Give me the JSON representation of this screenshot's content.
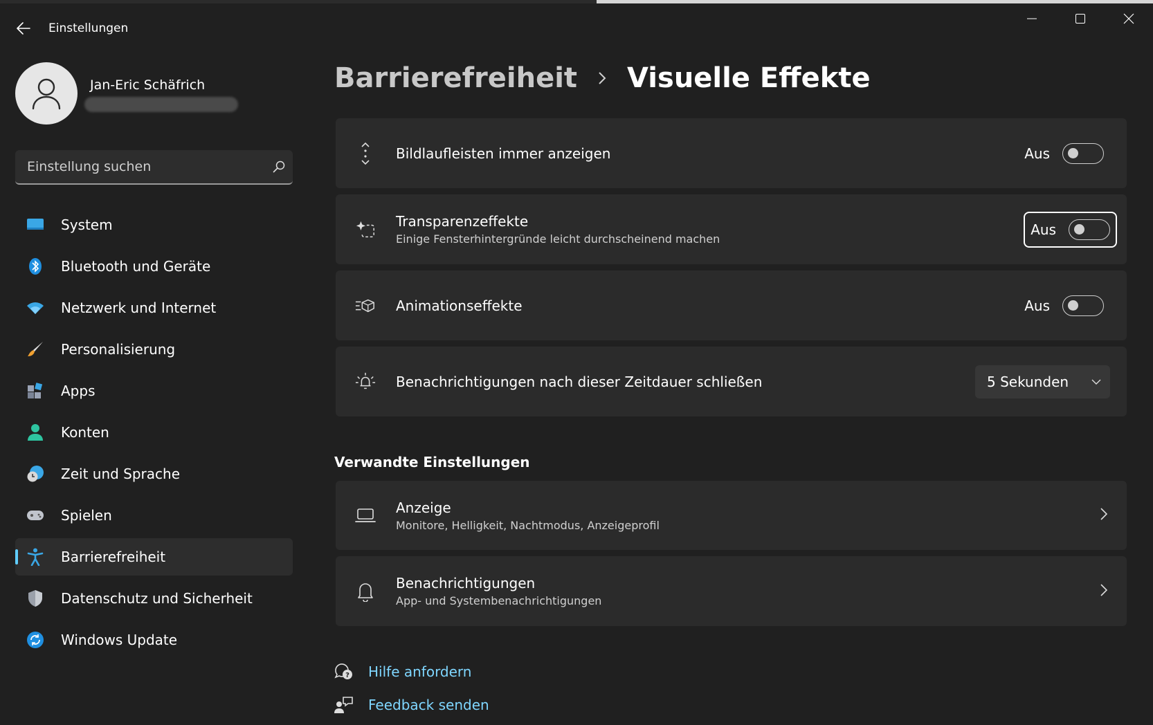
{
  "window": {
    "title": "Einstellungen"
  },
  "profile": {
    "name": "Jan-Eric Schäfrich"
  },
  "search": {
    "placeholder": "Einstellung suchen"
  },
  "nav": {
    "items": [
      {
        "label": "System",
        "icon": "system-icon"
      },
      {
        "label": "Bluetooth und Geräte",
        "icon": "bluetooth-icon"
      },
      {
        "label": "Netzwerk und Internet",
        "icon": "wifi-icon"
      },
      {
        "label": "Personalisierung",
        "icon": "brush-icon"
      },
      {
        "label": "Apps",
        "icon": "apps-icon"
      },
      {
        "label": "Konten",
        "icon": "account-icon"
      },
      {
        "label": "Zeit und Sprache",
        "icon": "clock-globe-icon"
      },
      {
        "label": "Spielen",
        "icon": "gamepad-icon"
      },
      {
        "label": "Barrierefreiheit",
        "icon": "accessibility-icon",
        "active": true
      },
      {
        "label": "Datenschutz und Sicherheit",
        "icon": "shield-icon"
      },
      {
        "label": "Windows Update",
        "icon": "update-icon"
      }
    ]
  },
  "breadcrumb": {
    "parent": "Barrierefreiheit",
    "current": "Visuelle Effekte"
  },
  "settings": {
    "scrollbars": {
      "title": "Bildlaufleisten immer anzeigen",
      "state_label": "Aus",
      "on": false
    },
    "transparency": {
      "title": "Transparenzeffekte",
      "subtitle": "Einige Fensterhintergründe leicht durchscheinend machen",
      "state_label": "Aus",
      "on": false
    },
    "animation": {
      "title": "Animationseffekte",
      "state_label": "Aus",
      "on": false
    },
    "notifications_timeout": {
      "title": "Benachrichtigungen nach dieser Zeitdauer schließen",
      "value": "5 Sekunden"
    }
  },
  "related": {
    "section_title": "Verwandte Einstellungen",
    "display": {
      "title": "Anzeige",
      "subtitle": "Monitore, Helligkeit, Nachtmodus, Anzeigeprofil"
    },
    "notifications": {
      "title": "Benachrichtigungen",
      "subtitle": "App- und Systembenachrichtigungen"
    }
  },
  "footer": {
    "help": "Hilfe anfordern",
    "feedback": "Feedback senden"
  },
  "colors": {
    "accent": "#60cdff",
    "link": "#7fd6ff",
    "background": "#202020",
    "card": "#2b2b2b"
  }
}
